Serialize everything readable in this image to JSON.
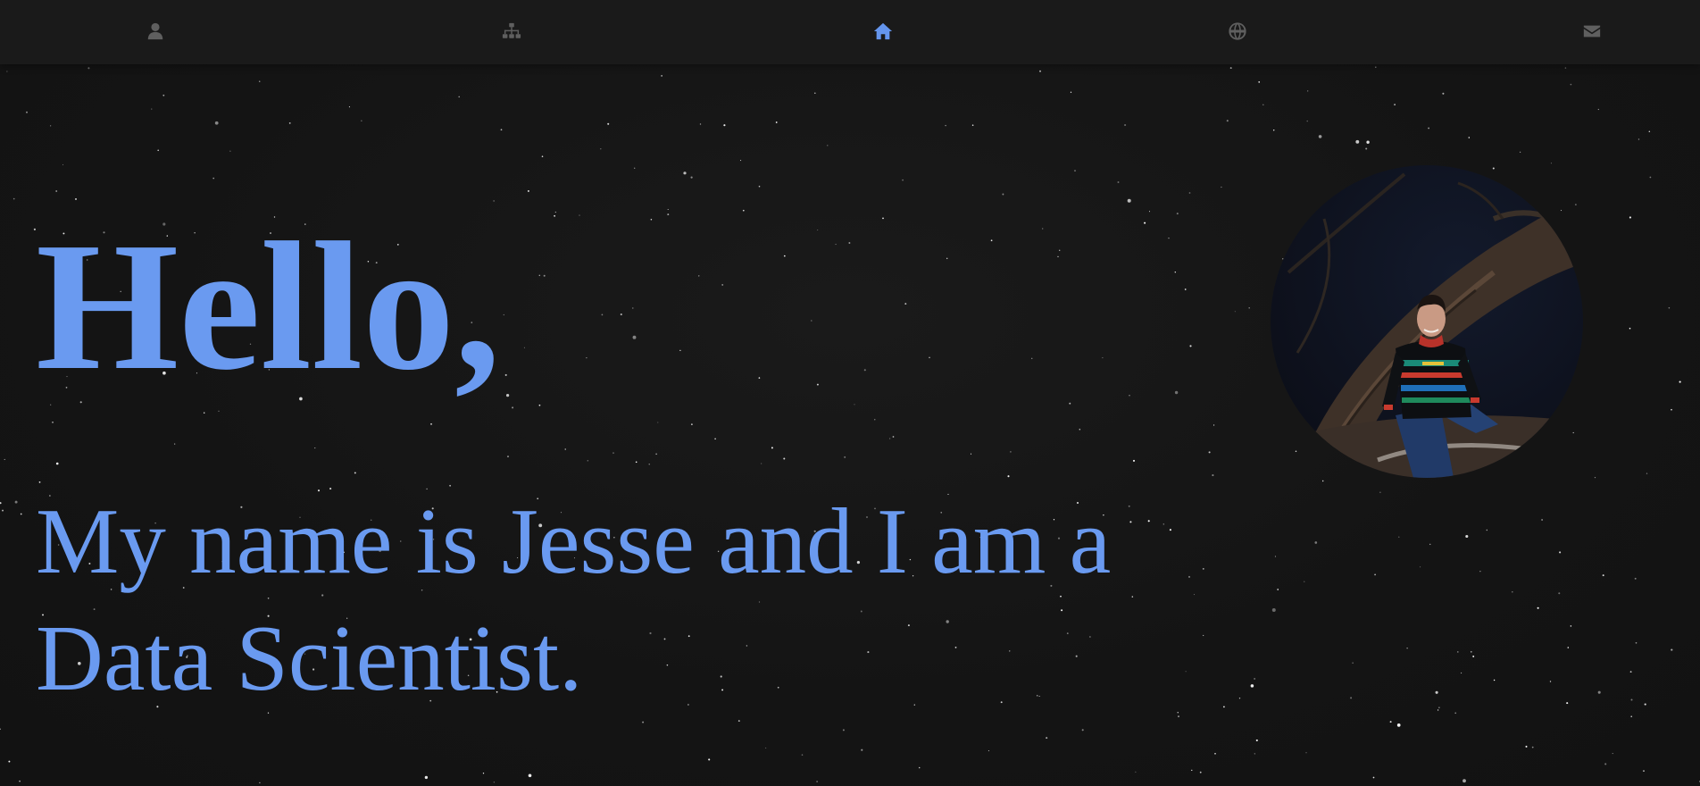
{
  "nav": {
    "items": [
      {
        "icon": "user-icon",
        "active": false
      },
      {
        "icon": "sitemap-icon",
        "active": false
      },
      {
        "icon": "home-icon",
        "active": true
      },
      {
        "icon": "globe-icon",
        "active": false
      },
      {
        "icon": "envelope-icon",
        "active": false
      }
    ]
  },
  "hero": {
    "greeting": "Hello,",
    "intro": "My name is Jesse and I am a Data Scientist."
  },
  "colors": {
    "accent": "#6a9af0",
    "background": "#141414",
    "nav_background": "#1a1a1a",
    "nav_icon_inactive": "#5f5f5f",
    "nav_icon_active": "#6495ed"
  }
}
